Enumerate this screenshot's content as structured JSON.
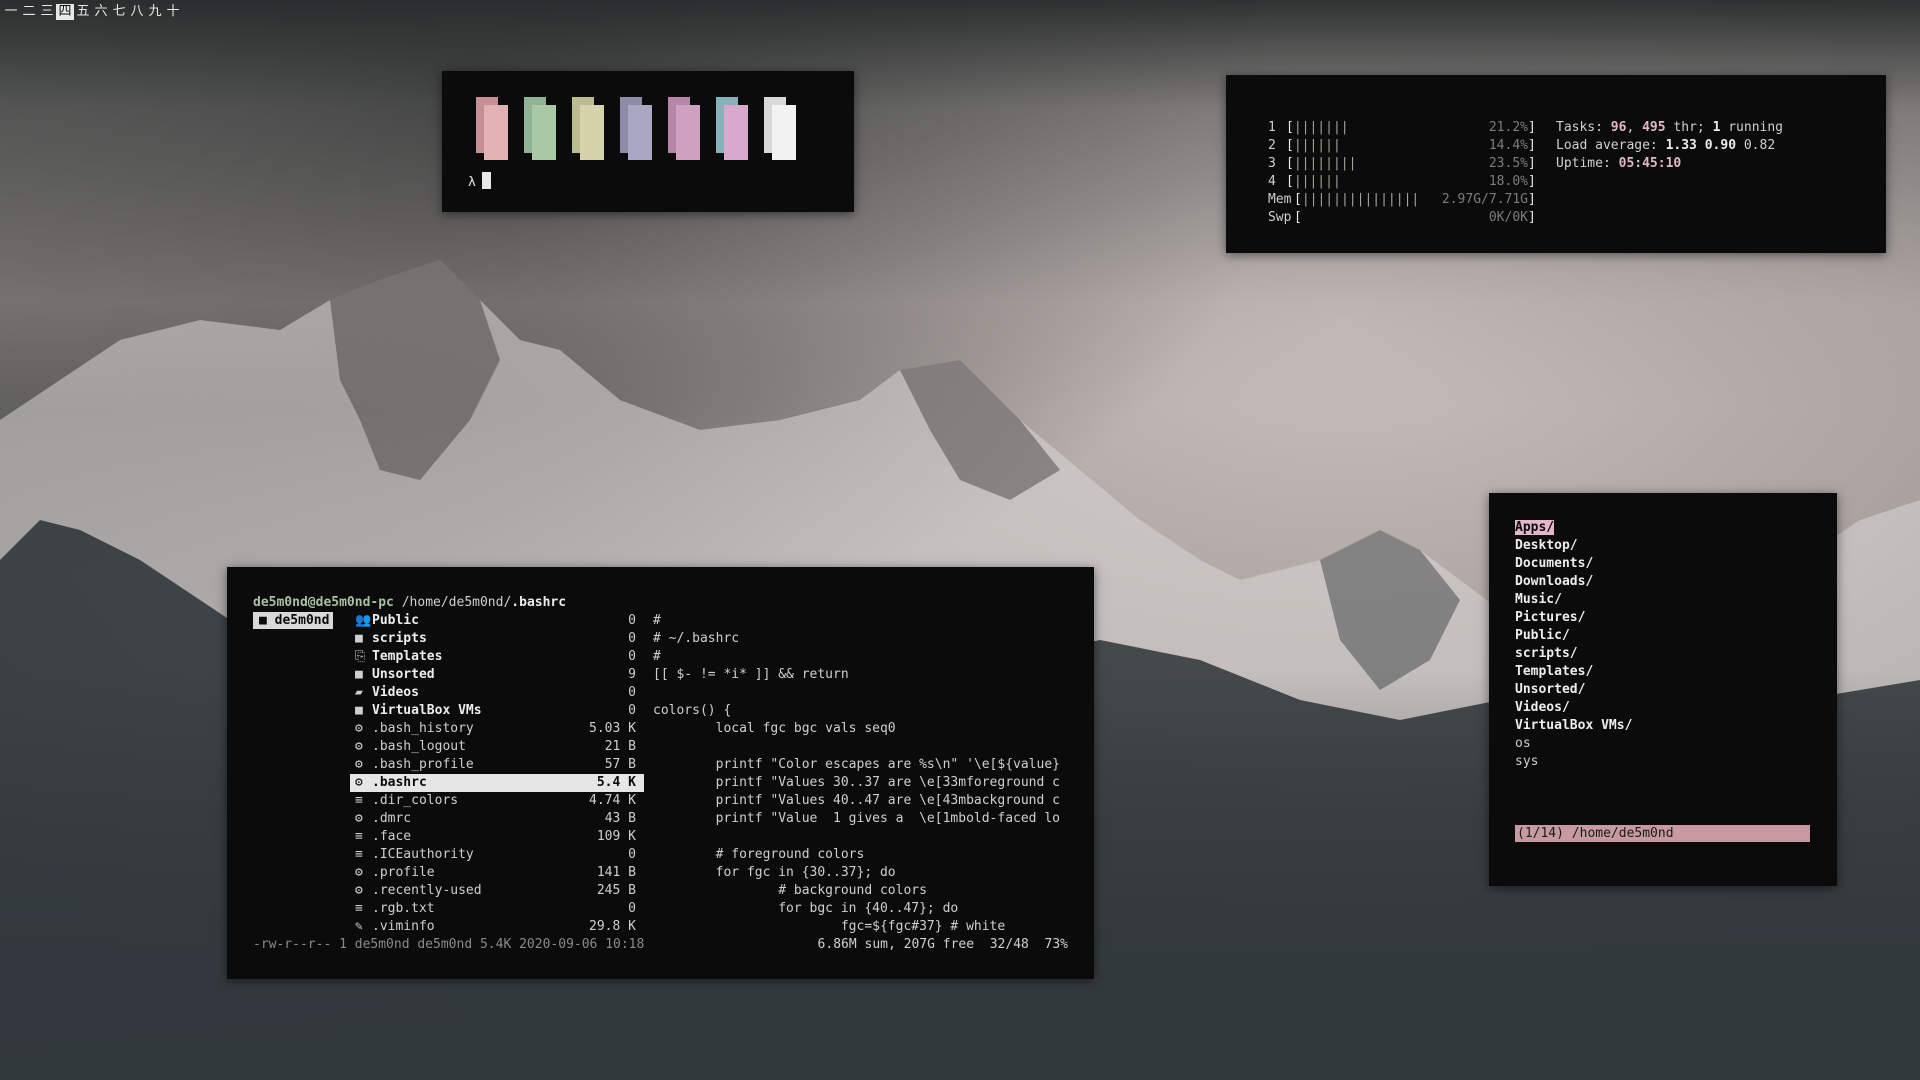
{
  "workspaces": {
    "items": [
      "一",
      "二",
      "三",
      "四",
      "五",
      "六",
      "七",
      "八",
      "九",
      "十"
    ],
    "active_index": 3
  },
  "palette_terminal": {
    "prompt_symbol": "λ",
    "swatches": [
      {
        "dark": "#c78f95",
        "light": "#e2b1b4"
      },
      {
        "dark": "#8fb394",
        "light": "#a9c8a6"
      },
      {
        "dark": "#bdbb94",
        "light": "#d6d2aa"
      },
      {
        "dark": "#8e8ba8",
        "light": "#aaa7c2"
      },
      {
        "dark": "#b487a9",
        "light": "#cfa0c0"
      },
      {
        "dark": "#88b0b8",
        "light": "#d7a8cc"
      },
      {
        "dark": "#d9d9d9",
        "light": "#f2f2f2"
      }
    ]
  },
  "htop": {
    "cpus": [
      {
        "num": "1",
        "bars": "|||||||",
        "value": "21.2%"
      },
      {
        "num": "2",
        "bars": "||||||",
        "value": "14.4%"
      },
      {
        "num": "3",
        "bars": "||||||||",
        "value": "23.5%"
      },
      {
        "num": "4",
        "bars": "||||||",
        "value": "18.0%"
      }
    ],
    "mem": {
      "label": "Mem",
      "bars": "|||||||||||||||",
      "value": "2.97G/7.71G"
    },
    "swp": {
      "label": "Swp",
      "bars": "",
      "value": "0K/0K"
    },
    "tasks": {
      "label": "Tasks:",
      "tasks": "96",
      "threads": "495",
      "thr_label": "thr;",
      "running": "1",
      "running_label": "running"
    },
    "load": {
      "label": "Load average:",
      "one": "1.33",
      "five": "0.90",
      "fifteen": "0.82"
    },
    "uptime": {
      "label": "Uptime:",
      "value": "05:45:10"
    }
  },
  "ranger": {
    "header": {
      "host": "de5m0nd@de5m0nd-pc",
      "path": "/home/de5m0nd/",
      "file": ".bashrc"
    },
    "parent_selected": "de5m0nd",
    "files": [
      {
        "icon": "users-icon",
        "glyph": "👥",
        "name": "Public",
        "size": "0",
        "dir": true
      },
      {
        "icon": "folder-icon",
        "glyph": "■",
        "name": "scripts",
        "size": "0",
        "dir": true
      },
      {
        "icon": "templates-icon",
        "glyph": "⎘",
        "name": "Templates",
        "size": "0",
        "dir": true
      },
      {
        "icon": "folder-icon",
        "glyph": "■",
        "name": "Unsorted",
        "size": "9",
        "dir": true
      },
      {
        "icon": "video-icon",
        "glyph": "▰",
        "name": "Videos",
        "size": "0",
        "dir": true
      },
      {
        "icon": "folder-icon",
        "glyph": "■",
        "name": "VirtualBox VMs",
        "size": "0",
        "dir": true
      },
      {
        "icon": "gear-icon",
        "glyph": "⚙",
        "name": ".bash_history",
        "size": "5.03 K",
        "dir": false
      },
      {
        "icon": "gear-icon",
        "glyph": "⚙",
        "name": ".bash_logout",
        "size": "21 B",
        "dir": false
      },
      {
        "icon": "gear-icon",
        "glyph": "⚙",
        "name": ".bash_profile",
        "size": "57 B",
        "dir": false
      },
      {
        "icon": "gear-icon",
        "glyph": "⚙",
        "name": ".bashrc",
        "size": "5.4 K",
        "dir": false,
        "selected": true
      },
      {
        "icon": "text-file-icon",
        "glyph": "≡",
        "name": ".dir_colors",
        "size": "4.74 K",
        "dir": false
      },
      {
        "icon": "gear-icon",
        "glyph": "⚙",
        "name": ".dmrc",
        "size": "43 B",
        "dir": false
      },
      {
        "icon": "text-file-icon",
        "glyph": "≡",
        "name": ".face",
        "size": "109 K",
        "dir": false
      },
      {
        "icon": "text-file-icon",
        "glyph": "≡",
        "name": ".ICEauthority",
        "size": "0",
        "dir": false
      },
      {
        "icon": "gear-icon",
        "glyph": "⚙",
        "name": ".profile",
        "size": "141 B",
        "dir": false
      },
      {
        "icon": "gear-icon",
        "glyph": "⚙",
        "name": ".recently-used",
        "size": "245 B",
        "dir": false
      },
      {
        "icon": "text-file-icon",
        "glyph": "≡",
        "name": ".rgb.txt",
        "size": "0",
        "dir": false
      },
      {
        "icon": "vim-icon",
        "glyph": "✎",
        "name": ".viminfo",
        "size": "29.8 K",
        "dir": false
      }
    ],
    "preview": [
      "#",
      "# ~/.bashrc",
      "#",
      "[[ $- != *i* ]] && return",
      "",
      "colors() {",
      "        local fgc bgc vals seq0",
      "",
      "        printf \"Color escapes are %s\\n\" '\\e[${value}",
      "        printf \"Values 30..37 are \\e[33mforeground c",
      "        printf \"Values 40..47 are \\e[43mbackground c",
      "        printf \"Value  1 gives a  \\e[1mbold-faced lo",
      "",
      "        # foreground colors",
      "        for fgc in {30..37}; do",
      "                # background colors",
      "                for bgc in {40..47}; do",
      "                        fgc=${fgc#37} # white"
    ],
    "status_left": "-rw-r--r-- 1 de5m0nd de5m0nd 5.4K 2020-09-06 10:18",
    "status_right": "6.86M sum, 207G free  32/48  73%"
  },
  "dir_picker": {
    "items": [
      {
        "name": "Apps/",
        "bold": true,
        "selected": true
      },
      {
        "name": "Desktop/",
        "bold": true
      },
      {
        "name": "Documents/",
        "bold": true
      },
      {
        "name": "Downloads/",
        "bold": true
      },
      {
        "name": "Music/",
        "bold": true
      },
      {
        "name": "Pictures/",
        "bold": true
      },
      {
        "name": "Public/",
        "bold": true
      },
      {
        "name": "scripts/",
        "bold": true
      },
      {
        "name": "Templates/",
        "bold": true
      },
      {
        "name": "Unsorted/",
        "bold": true
      },
      {
        "name": "Videos/",
        "bold": true
      },
      {
        "name": "VirtualBox VMs/",
        "bold": true
      },
      {
        "name": "os",
        "bold": false
      },
      {
        "name": "sys",
        "bold": false
      }
    ],
    "status": "(1/14) /home/de5m0nd"
  }
}
